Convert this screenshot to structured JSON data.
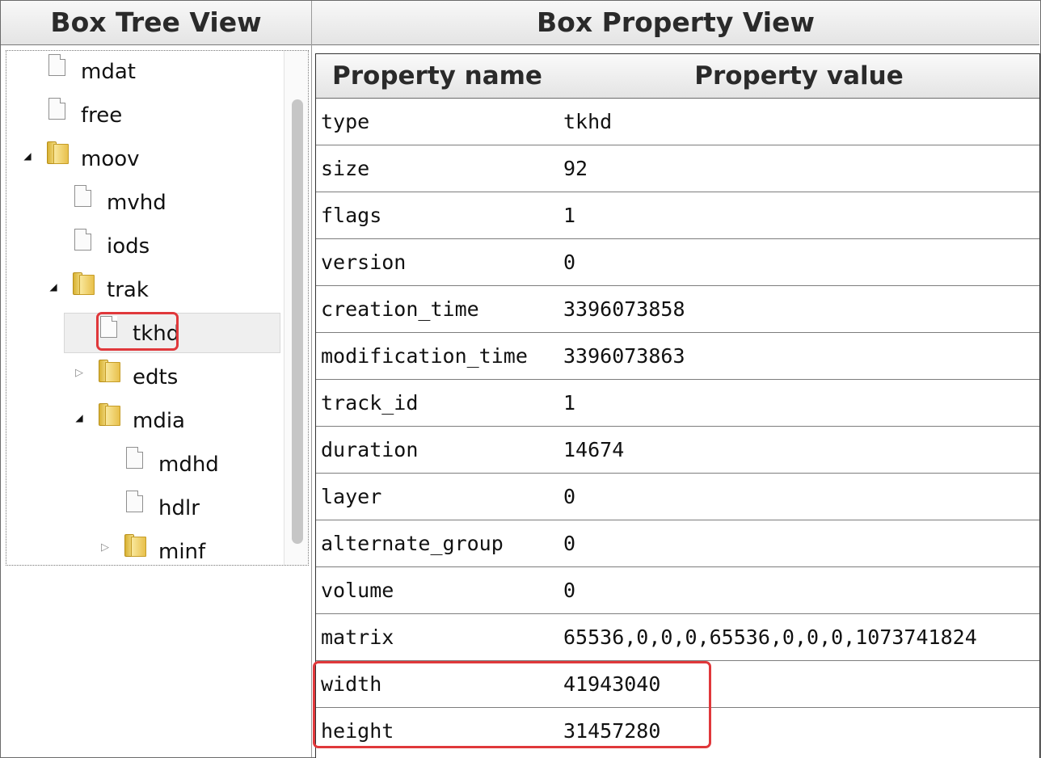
{
  "headers": {
    "tree_view": "Box Tree View",
    "property_view": "Box Property View"
  },
  "tree": {
    "items": [
      {
        "label": "mdat",
        "icon": "file-icon"
      },
      {
        "label": "free",
        "icon": "file-icon"
      },
      {
        "label": "moov",
        "icon": "folder-icon",
        "expanded": true
      },
      {
        "label": "mvhd",
        "icon": "file-icon"
      },
      {
        "label": "iods",
        "icon": "file-icon"
      },
      {
        "label": "trak",
        "icon": "folder-icon",
        "expanded": true
      },
      {
        "label": "tkhd",
        "icon": "file-icon",
        "selected": true
      },
      {
        "label": "edts",
        "icon": "folder-icon",
        "expanded": false
      },
      {
        "label": "mdia",
        "icon": "folder-icon",
        "expanded": true
      },
      {
        "label": "mdhd",
        "icon": "file-icon"
      },
      {
        "label": "hdlr",
        "icon": "file-icon"
      },
      {
        "label": "minf",
        "icon": "folder-icon",
        "expanded": false
      }
    ]
  },
  "property_table": {
    "col_name": "Property name",
    "col_value": "Property value",
    "rows": [
      {
        "name": "type",
        "value": "tkhd"
      },
      {
        "name": "size",
        "value": "92"
      },
      {
        "name": "flags",
        "value": "1"
      },
      {
        "name": "version",
        "value": "0"
      },
      {
        "name": "creation_time",
        "value": "3396073858"
      },
      {
        "name": "modification_time",
        "value": "3396073863"
      },
      {
        "name": "track_id",
        "value": "1"
      },
      {
        "name": "duration",
        "value": "14674"
      },
      {
        "name": "layer",
        "value": "0"
      },
      {
        "name": "alternate_group",
        "value": "0"
      },
      {
        "name": "volume",
        "value": "0"
      },
      {
        "name": "matrix",
        "value": "65536,0,0,0,65536,0,0,0,1073741824"
      },
      {
        "name": "width",
        "value": "41943040"
      },
      {
        "name": "height",
        "value": "31457280"
      }
    ]
  },
  "colors": {
    "highlight_red": "#e0383b",
    "selection_bg": "#efefef"
  }
}
